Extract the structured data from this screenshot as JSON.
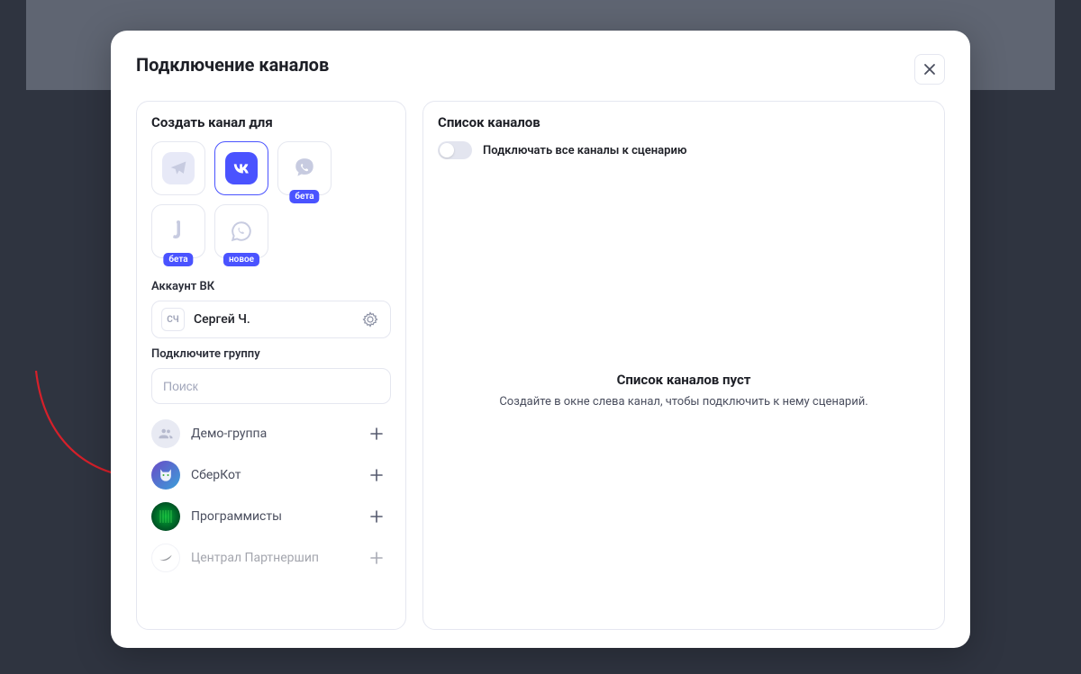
{
  "modal": {
    "title": "Подключение каналов"
  },
  "left": {
    "label": "Создать канал для",
    "channels": [
      {
        "id": "telegram",
        "badge": null
      },
      {
        "id": "vk",
        "badge": null,
        "selected": true
      },
      {
        "id": "viber",
        "badge": "бета"
      },
      {
        "id": "jivo",
        "badge": "бета"
      },
      {
        "id": "whatsapp",
        "badge": "новое"
      }
    ],
    "account_label": "Аккаунт ВК",
    "account": {
      "initials": "СЧ",
      "name": "Сергей Ч."
    },
    "groups_label": "Подключите группу",
    "search_placeholder": "Поиск",
    "groups": [
      {
        "name": "Демо-группа",
        "avatar_kind": "placeholder"
      },
      {
        "name": "СберКот",
        "avatar_kind": "sberkot"
      },
      {
        "name": "Программисты",
        "avatar_kind": "matrix"
      },
      {
        "name": "Централ Партнершип",
        "avatar_kind": "cp",
        "faded": true
      }
    ]
  },
  "right": {
    "label": "Список каналов",
    "toggle_label": "Подключать все каналы к сценарию",
    "empty_title": "Список каналов пуст",
    "empty_sub": "Создайте в окне слева канал, чтобы подключить к нему сценарий."
  },
  "colors": {
    "accent": "#4a53ff",
    "muted": "#c7cbe0"
  }
}
